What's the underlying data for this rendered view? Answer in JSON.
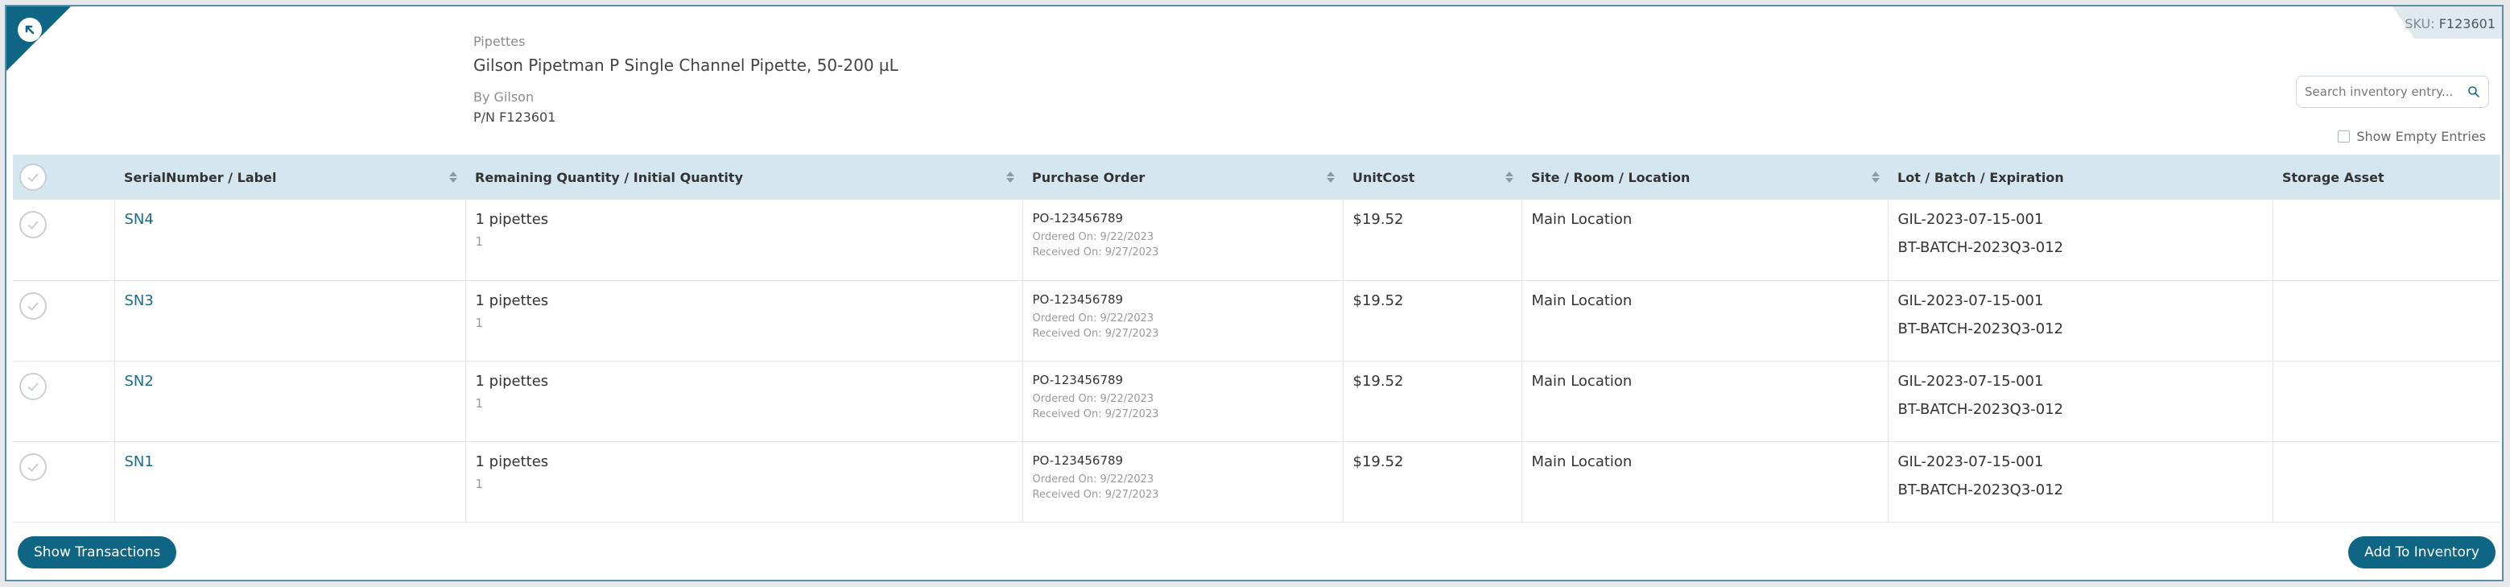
{
  "header": {
    "sku_label": "SKU:",
    "sku_value": "F123601",
    "category": "Pipettes",
    "product_name": "Gilson Pipetman P Single Channel Pipette, 50-200 µL",
    "byline": "By Gilson",
    "part_number": "P/N F123601"
  },
  "search": {
    "placeholder": "Search inventory entry..."
  },
  "show_empty_label": "Show Empty Entries",
  "table": {
    "columns": [
      "SerialNumber / Label",
      "Remaining Quantity / Initial Quantity",
      "Purchase Order",
      "UnitCost",
      "Site / Room / Location",
      "Lot / Batch / Expiration",
      "Storage Asset"
    ],
    "rows": [
      {
        "serial": "SN4",
        "remaining": "1 pipettes",
        "initial": "1",
        "po": "PO-123456789",
        "ordered": "Ordered On:  9/22/2023",
        "received": "Received On:  9/27/2023",
        "unit_cost": "$19.52",
        "location": "Main Location",
        "lot": "GIL-2023-07-15-001",
        "batch": "BT-BATCH-2023Q3-012",
        "storage_asset": ""
      },
      {
        "serial": "SN3",
        "remaining": "1 pipettes",
        "initial": "1",
        "po": "PO-123456789",
        "ordered": "Ordered On:  9/22/2023",
        "received": "Received On:  9/27/2023",
        "unit_cost": "$19.52",
        "location": "Main Location",
        "lot": "GIL-2023-07-15-001",
        "batch": "BT-BATCH-2023Q3-012",
        "storage_asset": ""
      },
      {
        "serial": "SN2",
        "remaining": "1 pipettes",
        "initial": "1",
        "po": "PO-123456789",
        "ordered": "Ordered On:  9/22/2023",
        "received": "Received On:  9/27/2023",
        "unit_cost": "$19.52",
        "location": "Main Location",
        "lot": "GIL-2023-07-15-001",
        "batch": "BT-BATCH-2023Q3-012",
        "storage_asset": ""
      },
      {
        "serial": "SN1",
        "remaining": "1 pipettes",
        "initial": "1",
        "po": "PO-123456789",
        "ordered": "Ordered On:  9/22/2023",
        "received": "Received On:  9/27/2023",
        "unit_cost": "$19.52",
        "location": "Main Location",
        "lot": "GIL-2023-07-15-001",
        "batch": "BT-BATCH-2023Q3-012",
        "storage_asset": ""
      }
    ]
  },
  "buttons": {
    "show_transactions": "Show Transactions",
    "add_to_inventory": "Add To Inventory"
  },
  "colors": {
    "accent": "#0f6584",
    "header_row": "#d5e6ef",
    "link": "#1d6a8a"
  }
}
